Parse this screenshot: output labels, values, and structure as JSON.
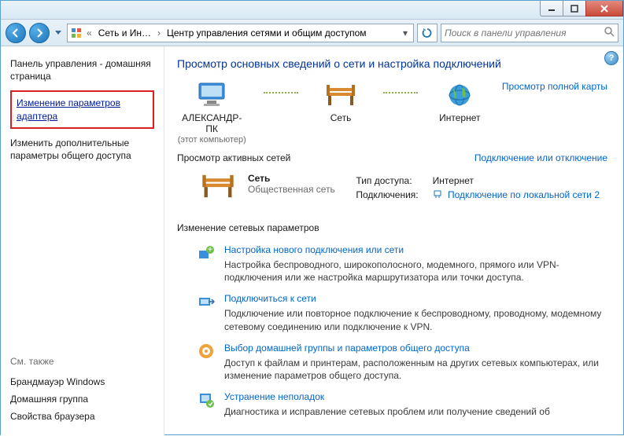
{
  "breadcrumb": {
    "seg1": "Сеть и Ин…",
    "seg2": "Центр управления сетями и общим доступом"
  },
  "search": {
    "placeholder": "Поиск в панели управления"
  },
  "sidebar": {
    "home": "Панель управления - домашняя страница",
    "adapter": "Изменение параметров адаптера",
    "sharing": "Изменить дополнительные параметры общего доступа",
    "see_also_title": "См. также",
    "see_also": {
      "firewall": "Брандмауэр Windows",
      "homegroup": "Домашняя группа",
      "browser": "Свойства браузера"
    }
  },
  "main": {
    "title": "Просмотр основных сведений о сети и настройка подключений",
    "full_map": "Просмотр полной карты",
    "map": {
      "pc": "АЛЕКСАНДР-ПК",
      "pc_sub": "(этот компьютер)",
      "net": "Сеть",
      "internet": "Интернет"
    },
    "active_head": "Просмотр активных сетей",
    "active_link": "Подключение или отключение",
    "active": {
      "name": "Сеть",
      "type": "Общественная сеть",
      "access_label": "Тип доступа:",
      "access_value": "Интернет",
      "conn_label": "Подключения:",
      "conn_value": "Подключение по локальной сети 2"
    },
    "settings_title": "Изменение сетевых параметров",
    "tasks": [
      {
        "title": "Настройка нового подключения или сети",
        "desc": "Настройка беспроводного, широкополосного, модемного, прямого или VPN-подключения или же настройка маршрутизатора или точки доступа."
      },
      {
        "title": "Подключиться к сети",
        "desc": "Подключение или повторное подключение к беспроводному, проводному, модемному сетевому соединению или подключение к VPN."
      },
      {
        "title": "Выбор домашней группы и параметров общего доступа",
        "desc": "Доступ к файлам и принтерам, расположенным на других сетевых компьютерах, или изменение параметров общего доступа."
      },
      {
        "title": "Устранение неполадок",
        "desc": "Диагностика и исправление сетевых проблем или получение сведений об"
      }
    ]
  }
}
